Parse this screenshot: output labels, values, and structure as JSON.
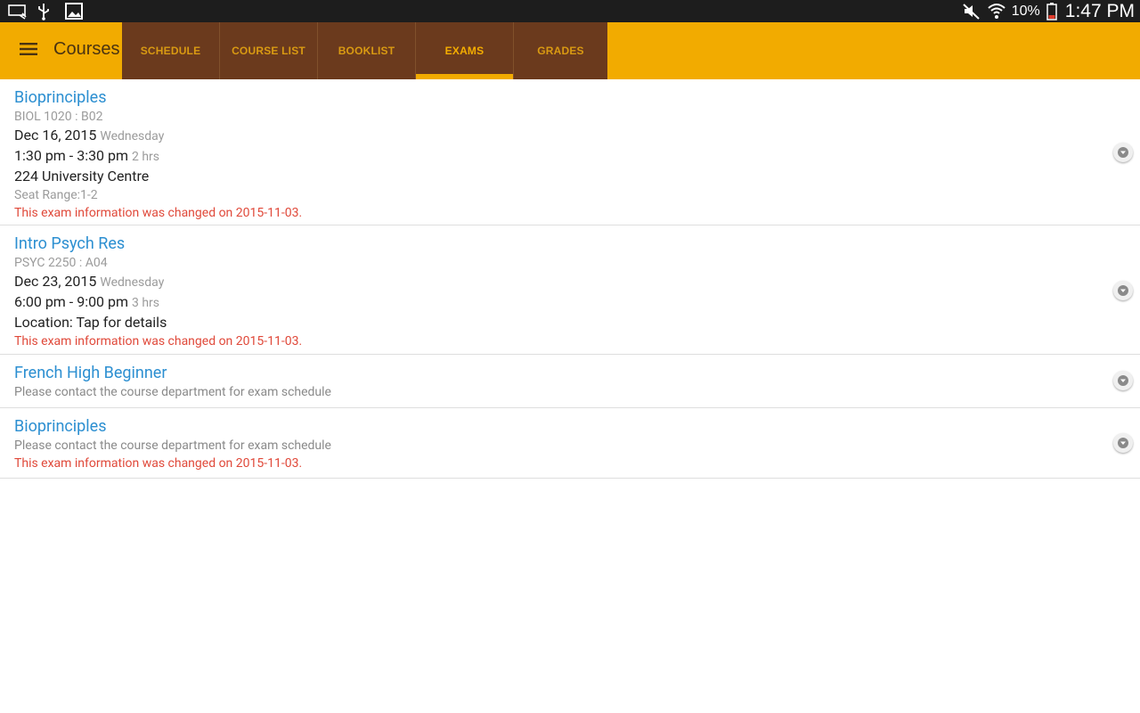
{
  "status_bar": {
    "left_icons": [
      "cast-icon",
      "usb-icon",
      "image-icon"
    ],
    "right_icons": [
      "mute-icon",
      "wifi-icon",
      "battery-icon"
    ],
    "battery_pct": "10%",
    "time": "1:47 PM"
  },
  "action_bar": {
    "title": "Courses",
    "menu_icon": "menu-icon",
    "tabs": [
      {
        "label": "SCHEDULE",
        "active": false
      },
      {
        "label": "COURSE LIST",
        "active": false
      },
      {
        "label": "BOOKLIST",
        "active": false
      },
      {
        "label": "EXAMS",
        "active": true
      },
      {
        "label": "GRADES",
        "active": false
      }
    ]
  },
  "colors": {
    "accent": "#f2ab00",
    "tab_bar": "#6b3a1d",
    "link_blue": "#2c8fd1",
    "warning_red": "#e0493a"
  },
  "exams": [
    {
      "title": "Bioprinciples",
      "code": "BIOL 1020 : B02",
      "date": "Dec 16, 2015",
      "weekday": "Wednesday",
      "time": "1:30 pm - 3:30 pm",
      "duration": "2 hrs",
      "location": "224 University Centre",
      "seat": "Seat Range:1-2",
      "changed": "This exam information was changed on 2015-11-03."
    },
    {
      "title": "Intro Psych Res",
      "code": "PSYC 2250 : A04",
      "date": "Dec 23, 2015",
      "weekday": "Wednesday",
      "time": "6:00 pm - 9:00 pm",
      "duration": "3 hrs",
      "location": "Location: Tap for details",
      "changed": "This exam information was changed on 2015-11-03."
    },
    {
      "title": "French High Beginner",
      "contact": "Please contact the course department for exam schedule"
    },
    {
      "title": "Bioprinciples",
      "contact": "Please contact the course department for exam schedule",
      "changed": "This exam information was changed on 2015-11-03."
    }
  ]
}
